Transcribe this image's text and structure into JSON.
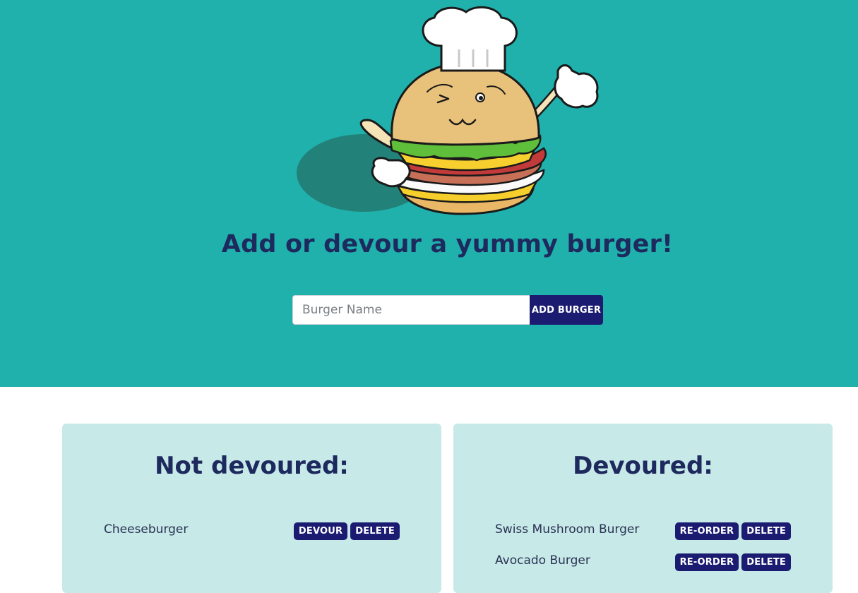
{
  "hero": {
    "title": "Add or devour a yummy burger!",
    "mascot": "chef-burger-mascot-illustration"
  },
  "form": {
    "placeholder": "Burger Name",
    "value": "",
    "add_label": "ADD BURGER"
  },
  "not_devoured": {
    "title": "Not devoured:",
    "items": [
      {
        "name": "Cheeseburger",
        "primary_label": "DEVOUR",
        "delete_label": "DELETE"
      }
    ]
  },
  "devoured": {
    "title": "Devoured:",
    "items": [
      {
        "name": "Swiss Mushroom Burger",
        "primary_label": "RE-ORDER",
        "delete_label": "DELETE"
      },
      {
        "name": "Avocado Burger",
        "primary_label": "RE-ORDER",
        "delete_label": "DELETE"
      }
    ]
  },
  "colors": {
    "hero_bg": "#20b1ad",
    "panel_bg": "#c7eae9",
    "button_bg": "#1b1b72",
    "heading": "#1e2a5e"
  }
}
